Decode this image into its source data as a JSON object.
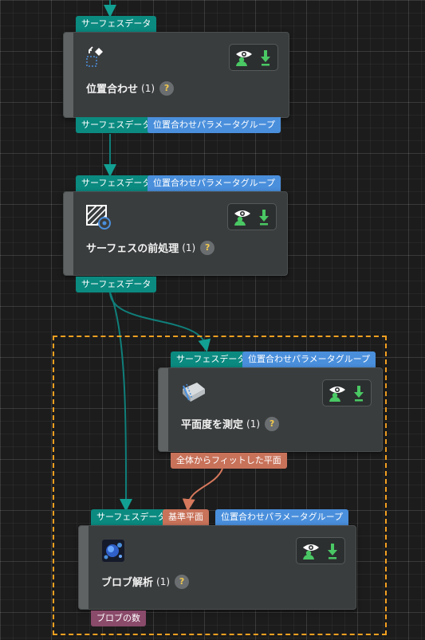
{
  "colors": {
    "teal": "#0b8a80",
    "blue": "#4a8fdc",
    "orange": "#c8725a",
    "purple": "#8a4a6a",
    "wire_teal": "#0f7f7a",
    "wire_orange": "#d6785c",
    "group_border": "#f5a020",
    "visibility_green": "#4ac864"
  },
  "ports": {
    "surface": "サーフェスデータ",
    "align_params": "位置合わせパラメータグループ",
    "fitted_plane": "全体からフィットした平面",
    "reference_plane": "基準平面",
    "blob_count": "ブロブの数"
  },
  "nodes": {
    "align": {
      "title": "位置合わせ",
      "count": "(1)",
      "icon": "align-icon",
      "help": "?"
    },
    "preprocess": {
      "title": "サーフェスの前処理",
      "count": "(1)",
      "icon": "surface-preprocess-icon",
      "help": "?"
    },
    "flatness": {
      "title": "平面度を測定",
      "count": "(1)",
      "icon": "flatness-icon",
      "help": "?"
    },
    "blob": {
      "title": "ブロブ解析",
      "count": "(1)",
      "icon": "blob-icon",
      "help": "?"
    }
  },
  "controls": {
    "visibility_icon": "eye-person-icon",
    "output_icon": "download-arrow-icon"
  }
}
